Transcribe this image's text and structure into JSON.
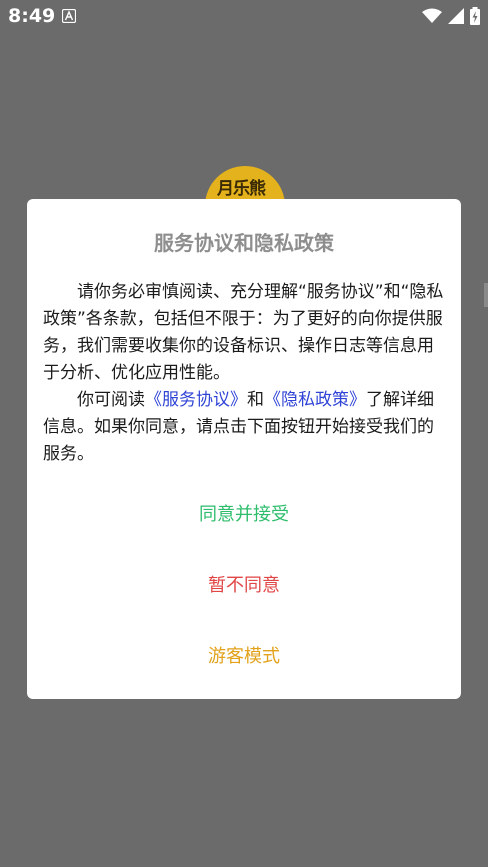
{
  "status_bar": {
    "time": "8:49",
    "icons": [
      "notification-a-icon",
      "wifi-icon",
      "signal-icon",
      "battery-charging-icon"
    ]
  },
  "background_logo": {
    "text": "月乐熊"
  },
  "dialog": {
    "title": "服务协议和隐私政策",
    "para1": "请你务必审慎阅读、充分理解“服务协议”和“隐私政策”各条款，包括但不限于：为了更好的向你提供服务，我们需要收集你的设备标识、操作日志等信息用于分析、优化应用性能。",
    "para2_prefix": "你可阅读",
    "link_service": "《服务协议》",
    "para2_and": "和",
    "link_privacy": "《隐私政策》",
    "para2_suffix": "了解详细信息。如果你同意，请点击下面按钮开始接受我们的服务。",
    "buttons": {
      "agree": "同意并接受",
      "disagree": "暂不同意",
      "guest": "游客模式"
    }
  },
  "colors": {
    "overlay": "#6b6b6b",
    "title": "#8e8e8e",
    "link": "#2f44d6",
    "agree": "#2dbd6b",
    "disagree": "#e14646",
    "guest": "#e2a21c"
  }
}
